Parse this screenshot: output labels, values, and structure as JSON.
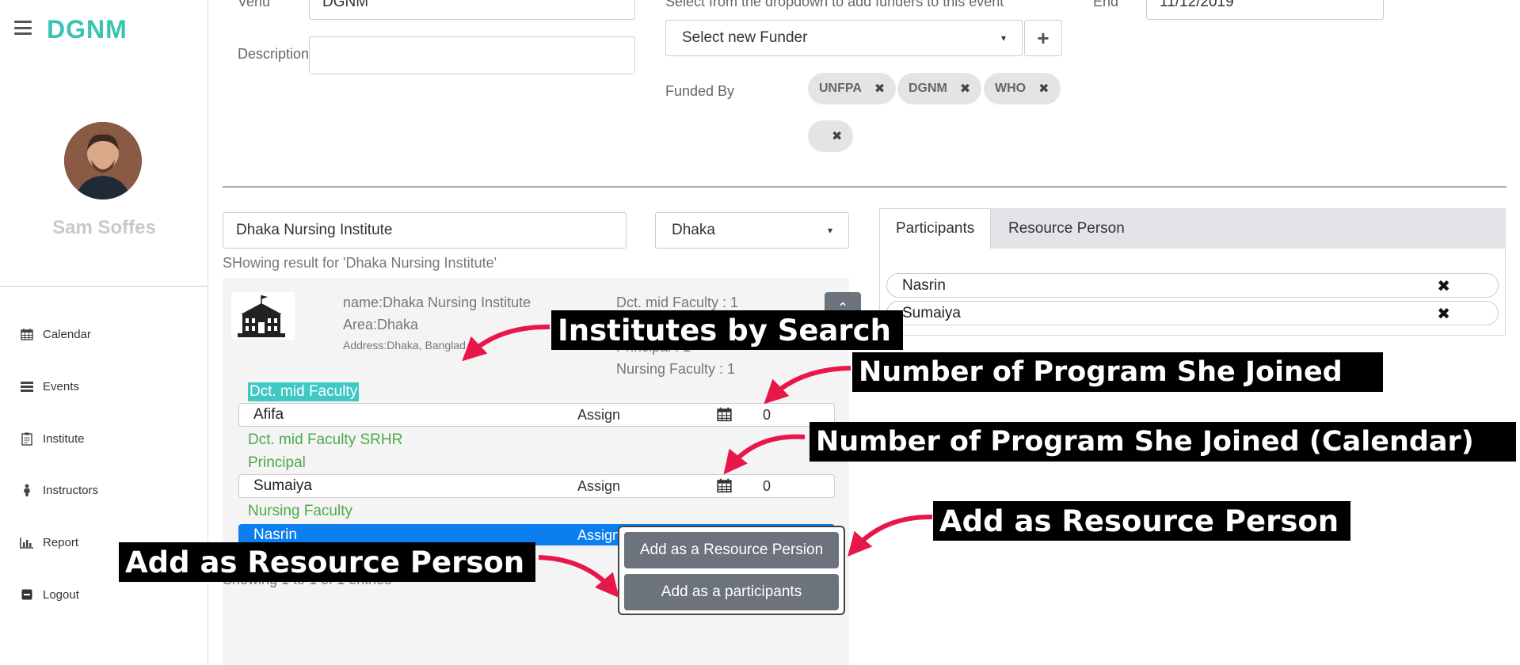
{
  "app": {
    "brand": "DGNM"
  },
  "user": {
    "name": "Sam Soffes"
  },
  "sidebar": {
    "items": [
      {
        "label": "Calendar",
        "icon": "calendar-icon"
      },
      {
        "label": "Events",
        "icon": "events-icon"
      },
      {
        "label": "Institute",
        "icon": "clipboard-icon"
      },
      {
        "label": "Instructors",
        "icon": "person-icon"
      },
      {
        "label": "Report",
        "icon": "bar-chart-icon"
      },
      {
        "label": "Logout",
        "icon": "logout-icon"
      }
    ]
  },
  "form": {
    "venue_label": "Venu",
    "venue_value": "DGNM",
    "description_label": "Description",
    "description_value": "",
    "funder_hint": "Select from the dropdown to add funders to this event",
    "funder_select": "Select new Funder",
    "funded_by_label": "Funded By",
    "funders": [
      "UNFPA",
      "DGNM",
      "WHO",
      ""
    ],
    "end_label": "End",
    "end_value": "11/12/2019"
  },
  "search": {
    "query": "Dhaka Nursing Institute",
    "district": "Dhaka",
    "result_text": "SHowing result for 'Dhaka Nursing Institute'",
    "footer_text": "Showing 1 to 1 of 1 entries"
  },
  "institute": {
    "name": "name:Dhaka Nursing Institute",
    "area": "Area:Dhaka",
    "address": "Address:Dhaka, Banglad",
    "stats": [
      "Dct. mid Faculty : 1",
      "Principal : 1",
      "Nursing Faculty : 1"
    ]
  },
  "groups": {
    "g1": "Dct. mid Faculty",
    "g2": "Dct. mid Faculty SRHR",
    "g3": "Principal",
    "g4": "Nursing Faculty"
  },
  "people": [
    {
      "name": "Afifa",
      "action": "Assign",
      "count": "0"
    },
    {
      "name": "Sumaiya",
      "action": "Assign",
      "count": "0"
    },
    {
      "name": "Nasrin",
      "action": "Assign",
      "count": ""
    }
  ],
  "tabs": {
    "participants": "Participants",
    "resource": "Resource Person"
  },
  "participants": [
    "Nasrin",
    "Sumaiya"
  ],
  "popup": {
    "resource_btn": "Add as a Resource Persion",
    "participant_btn": "Add as a participants"
  },
  "annotations": {
    "a1": "Institutes by Search",
    "a2": "Number of Program She Joined",
    "a3": "Number of Program She Joined (Calendar)",
    "a4": "Add as Resource Person",
    "a5": "Add as Resource Person"
  },
  "colors": {
    "brand": "#38c3b4",
    "selected": "#0b7ff0",
    "green": "#4caa4a",
    "arrow": "#e8174a",
    "button": "#6c737c"
  }
}
